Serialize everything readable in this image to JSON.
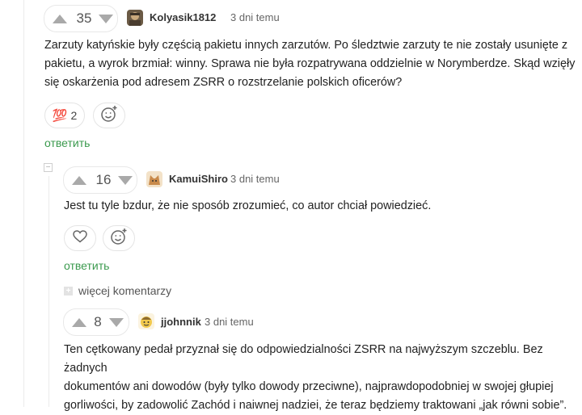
{
  "comments": [
    {
      "score": "35",
      "author": "Kolyasik1812",
      "time": "3 dni temu",
      "text_lines": [
        "Zarzuty katyńskie były częścią pakietu innych zarzutów. Po śledztwie zarzuty te nie zostały usunięte z",
        "pakietu, a wyrok brzmiał: winny. Sprawa nie była rozpatrywana oddzielnie w Norymberdze. Skąd wzięły",
        "się oskarżenia pod adresem ZSRR o rozstrzelanie polskich oficerów?"
      ],
      "reaction_emoji": "💯",
      "reaction_count": "2",
      "reply_label": "ответить"
    },
    {
      "score": "16",
      "author": "KamuiShiro",
      "time": "3 dni temu",
      "text_lines": [
        "Jest tu tyle bzdur, że nie sposób zrozumieć, co autor chciał powiedzieć."
      ],
      "reply_label": "ответить"
    },
    {
      "score": "8",
      "author": "jjohnnik",
      "time": "3 dni temu",
      "text_lines": [
        "Ten cętkowany pedał przyznał się do odpowiedzialności ZSRR na najwyższym szczeblu. Bez żadnych",
        "dokumentów ani dowodów (były tylko dowody przeciwne), najprawdopodobniej w swojej głupiej",
        "gorliwości, by zadowolić Zachód i naiwnej nadziei, że teraz będziemy traktowani „jak równi sobie”."
      ]
    }
  ],
  "more_comments_label": "więcej komentarzy",
  "collapse_symbol": "−",
  "icons": {
    "upvote": "triangle-up-icon",
    "downvote": "triangle-down-icon",
    "heart": "heart-icon",
    "add_reaction": "smiley-plus-icon"
  },
  "colors": {
    "reply_link": "#3b9a4e",
    "vote_arrow": "#a9a9a9"
  }
}
